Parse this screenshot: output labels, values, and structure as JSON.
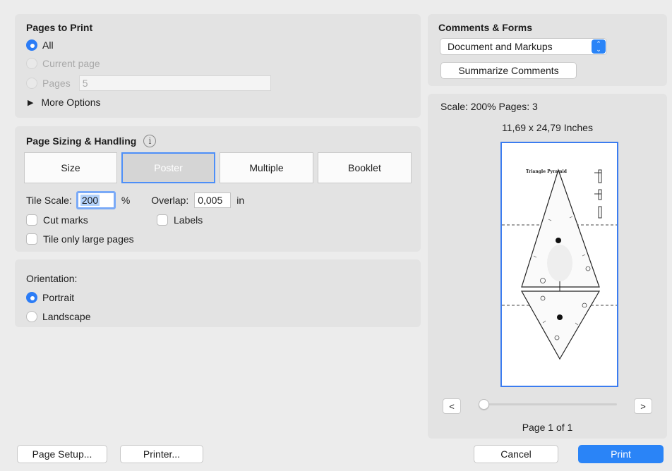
{
  "pages_to_print": {
    "title": "Pages to Print",
    "all_label": "All",
    "current_page_label": "Current page",
    "pages_label": "Pages",
    "pages_value": "5",
    "more_options_label": "More Options"
  },
  "sizing": {
    "title": "Page Sizing & Handling",
    "info_icon": "info-icon",
    "tabs": [
      "Size",
      "Poster",
      "Multiple",
      "Booklet"
    ],
    "active_tab": "Poster",
    "tile_scale_label": "Tile Scale:",
    "tile_scale_value": "200",
    "tile_scale_unit": "%",
    "overlap_label": "Overlap:",
    "overlap_value": "0,005",
    "overlap_unit": "in",
    "cut_marks_label": "Cut marks",
    "labels_label": "Labels",
    "tile_large_label": "Tile only large pages"
  },
  "orientation": {
    "title": "Orientation:",
    "portrait_label": "Portrait",
    "landscape_label": "Landscape"
  },
  "comments": {
    "title": "Comments & Forms",
    "select_value": "Document and Markups",
    "summarize_label": "Summarize Comments"
  },
  "preview": {
    "scale_text": "Scale: 200% Pages: 3",
    "size_text": "11,69 x 24,79 Inches",
    "doc_title": "Triangle Pyramid",
    "prev_label": "<",
    "next_label": ">",
    "page_text": "Page 1 of 1",
    "slider_fraction": 0
  },
  "footer": {
    "page_setup_label": "Page Setup...",
    "printer_label": "Printer...",
    "cancel_label": "Cancel",
    "print_label": "Print"
  },
  "colors": {
    "accent": "#2a84f7"
  }
}
